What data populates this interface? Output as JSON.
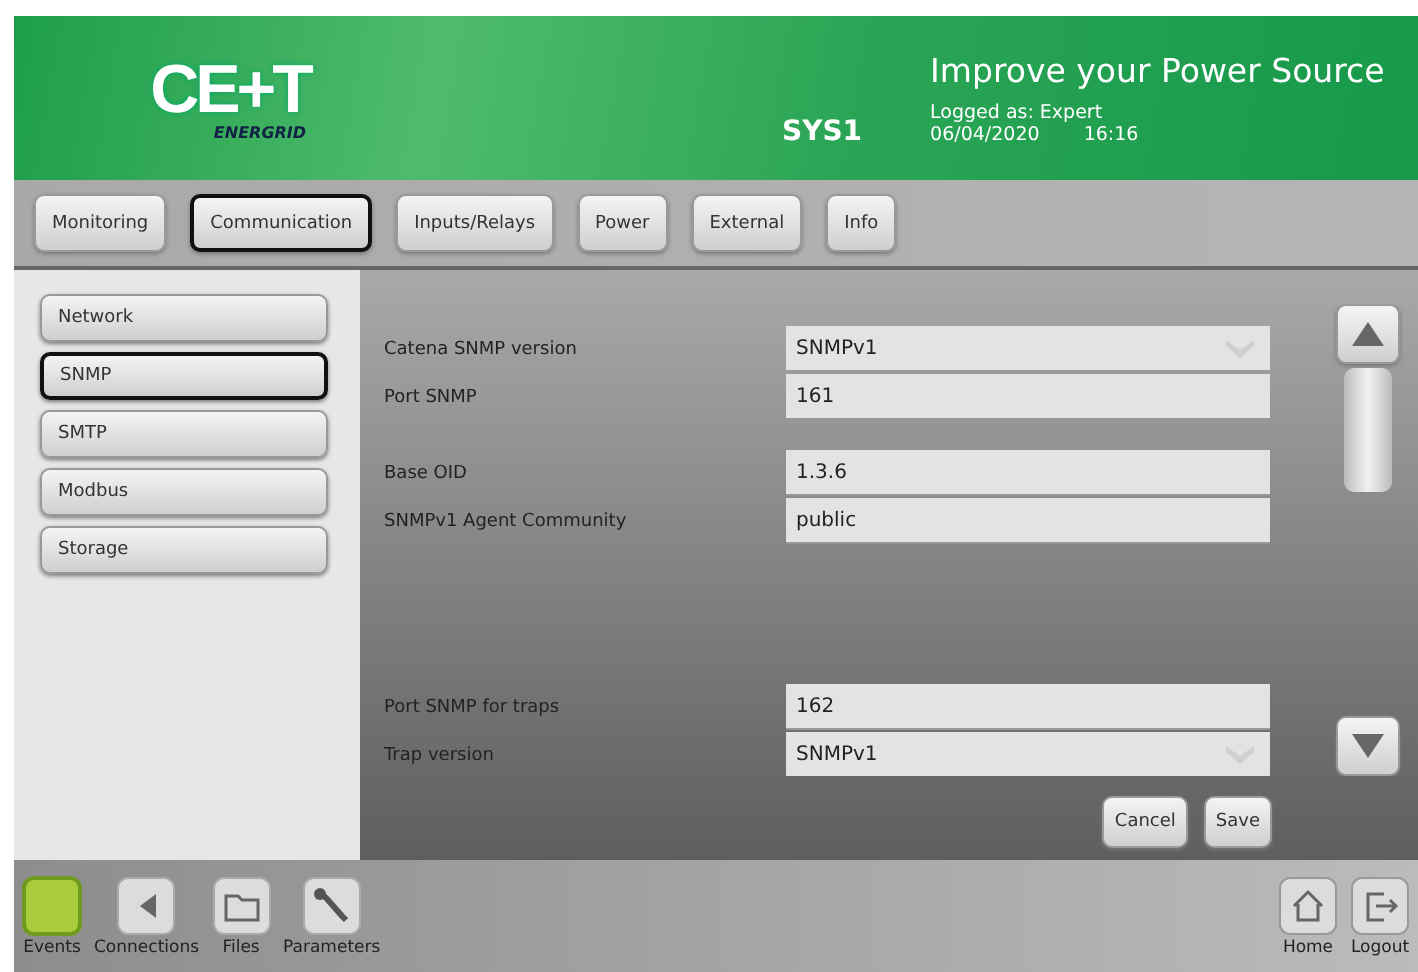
{
  "header": {
    "logo": {
      "mark": "CE+T",
      "sub": "ENERGRID"
    },
    "slogan": "Improve your Power Source",
    "system": "SYS1",
    "login": "Logged as: Expert",
    "date": "06/04/2020",
    "time": "16:16"
  },
  "tabs": [
    {
      "label": "Monitoring",
      "selected": false
    },
    {
      "label": "Communication",
      "selected": true
    },
    {
      "label": "Inputs/Relays",
      "selected": false
    },
    {
      "label": "Power",
      "selected": false
    },
    {
      "label": "External",
      "selected": false
    },
    {
      "label": "Info",
      "selected": false
    }
  ],
  "sidebar": {
    "items": [
      {
        "label": "Network",
        "selected": false
      },
      {
        "label": "SNMP",
        "selected": true
      },
      {
        "label": "SMTP",
        "selected": false
      },
      {
        "label": "Modbus",
        "selected": false
      },
      {
        "label": "Storage",
        "selected": false
      }
    ]
  },
  "form": {
    "groups": [
      [
        {
          "label": "Catena SNMP version",
          "kind": "select",
          "value": "SNMPv1"
        },
        {
          "label": "Port SNMP",
          "kind": "text",
          "value": "161"
        }
      ],
      [
        {
          "label": "Base OID",
          "kind": "text",
          "value": "1.3.6"
        },
        {
          "label": "SNMPv1 Agent Community",
          "kind": "text",
          "value": "public"
        }
      ],
      [
        {
          "label": "Port SNMP for traps",
          "kind": "text",
          "value": "162"
        },
        {
          "label": "Trap version",
          "kind": "select",
          "value": "SNMPv1"
        },
        {
          "kind": "cut"
        }
      ]
    ],
    "buttons": [
      "Cancel",
      "Save"
    ]
  },
  "bottom_bar": {
    "left": [
      {
        "label": "Events",
        "kind": "events"
      },
      {
        "label": "Connections",
        "kind": "connections"
      },
      {
        "label": "Files",
        "kind": "files"
      },
      {
        "label": "Parameters",
        "kind": "parameters"
      }
    ],
    "right": [
      {
        "label": "Home",
        "kind": "home"
      },
      {
        "label": "Logout",
        "kind": "logout"
      }
    ]
  }
}
